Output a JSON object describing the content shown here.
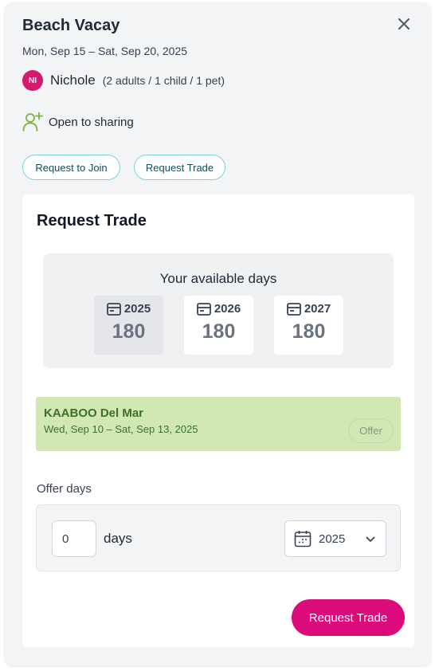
{
  "header": {
    "title": "Beach Vacay",
    "dates": "Mon, Sep 15 – Sat, Sep 20, 2025",
    "close_icon": "close-icon"
  },
  "host": {
    "initials": "NI",
    "name": "Nichole",
    "party": "(2 adults / 1 child / 1 pet)",
    "avatar_color": "#d6186f"
  },
  "sharing": {
    "icon": "add-user-icon",
    "label": "Open to sharing",
    "icon_color": "#7cb342"
  },
  "actions": {
    "join_label": "Request to Join",
    "trade_label": "Request Trade"
  },
  "trade_card": {
    "title": "Request Trade",
    "available_days": {
      "title": "Your available days",
      "years": [
        {
          "year": "2025",
          "days": "180",
          "selected": true
        },
        {
          "year": "2026",
          "days": "180",
          "selected": false
        },
        {
          "year": "2027",
          "days": "180",
          "selected": false
        }
      ]
    },
    "offer": {
      "name": "KAABOO Del Mar",
      "dates": "Wed, Sep 10 – Sat, Sep 13, 2025",
      "badge": "Offer",
      "background": "#d2e8b4"
    },
    "offer_days": {
      "label": "Offer days",
      "value": "0",
      "unit": "days",
      "year_selected": "2025"
    },
    "submit_label": "Request Trade",
    "accent_color": "#db0b7c"
  }
}
